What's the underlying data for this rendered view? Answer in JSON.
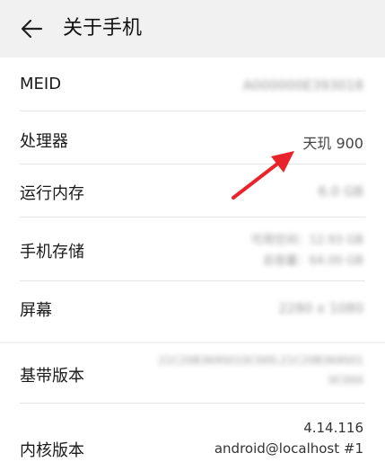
{
  "header": {
    "title": "关于手机",
    "back_icon": "arrow-left-icon"
  },
  "rows": [
    {
      "label": "MEID",
      "value": "A000000E393018",
      "blurred": true
    },
    {
      "label": "处理器",
      "value": "天玑 900",
      "blurred": false
    },
    {
      "label": "运行内存",
      "value": "6.0 GB",
      "blurred": true
    },
    {
      "label": "手机存储",
      "value_lines": [
        "可用空间：12.93 GB",
        "总容量：64.00 GB"
      ],
      "blurred": true
    },
    {
      "label": "屏幕",
      "value": "2280 x 1080",
      "blurred": true
    },
    {
      "label": "基带版本",
      "value_lines": [
        "21C20B369S010C000,21C20B369S01",
        "0C000"
      ],
      "blurred": true
    },
    {
      "label": "内核版本",
      "value_lines": [
        "4.14.116",
        "android@localhost #1"
      ],
      "blurred": false
    }
  ],
  "annotation": {
    "color": "#e8232b",
    "icon": "red-arrow-annotation"
  }
}
